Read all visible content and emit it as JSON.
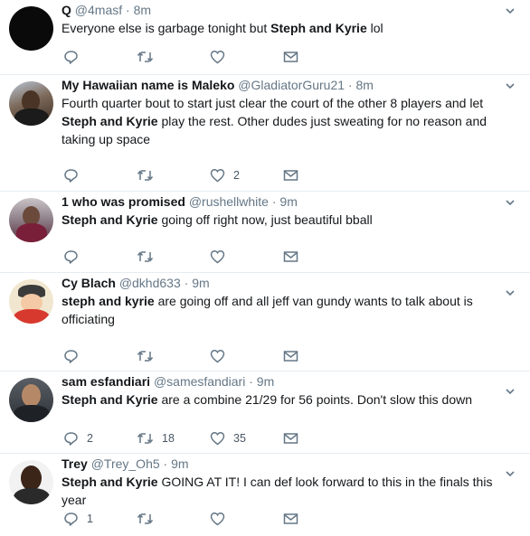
{
  "colors": {
    "text": "#14171a",
    "muted": "#657786",
    "border": "#e6ecf0"
  },
  "tweets": [
    {
      "name": "Q",
      "handle": "@4masf",
      "time": "8m",
      "text": [
        [
          "Everyone else is garbage tonight but ",
          false
        ],
        [
          "Steph and Kyrie",
          true
        ],
        [
          " lol",
          false
        ]
      ],
      "replies": "",
      "retweets": "",
      "likes": ""
    },
    {
      "name": "My Hawaiian name is Maleko",
      "handle": "@GladiatorGuru21",
      "time": "8m",
      "text": [
        [
          "Fourth quarter bout to start just clear the court of the other 8 players and let ",
          false
        ],
        [
          "Steph and Kyrie",
          true
        ],
        [
          " play the rest. Other dudes just sweating for no reason and taking up space",
          false
        ]
      ],
      "replies": "",
      "retweets": "",
      "likes": "2"
    },
    {
      "name": "1 who was promised",
      "handle": "@rushellwhite",
      "time": "9m",
      "text": [
        [
          "Steph and Kyrie",
          true
        ],
        [
          " going off right now, just beautiful bball",
          false
        ]
      ],
      "replies": "",
      "retweets": "",
      "likes": ""
    },
    {
      "name": "Cy Blach",
      "handle": "@dkhd633",
      "time": "9m",
      "text": [
        [
          "steph and kyrie",
          true
        ],
        [
          " are going off and all jeff van gundy wants to talk about is officiating",
          false
        ]
      ],
      "replies": "",
      "retweets": "",
      "likes": ""
    },
    {
      "name": "sam esfandiari",
      "handle": "@samesfandiari",
      "time": "9m",
      "text": [
        [
          "Steph and Kyrie",
          true
        ],
        [
          " are a combine 21/29 for 56 points. Don't slow this down",
          false
        ]
      ],
      "replies": "2",
      "retweets": "18",
      "likes": "35"
    },
    {
      "name": "Trey",
      "handle": "@Trey_Oh5",
      "time": "9m",
      "text": [
        [
          "Steph and Kyrie",
          true
        ],
        [
          " GOING AT IT! I can def look forward to this in the finals this year",
          false
        ]
      ],
      "replies": "1",
      "retweets": "",
      "likes": ""
    }
  ],
  "icons": {
    "reply": "reply-icon",
    "retweet": "retweet-icon",
    "like": "heart-icon",
    "dm": "envelope-icon",
    "caret": "chevron-down-icon"
  },
  "separator": "·"
}
